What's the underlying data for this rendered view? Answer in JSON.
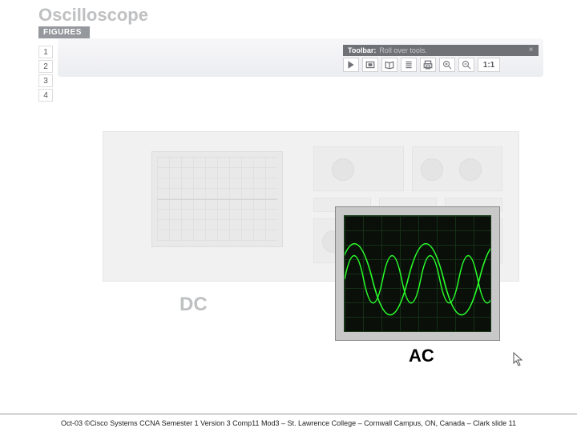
{
  "title": "Oscilloscope",
  "figures_tab": "FIGURES",
  "page_buttons": [
    "1",
    "2",
    "3",
    "4"
  ],
  "toolbar": {
    "label": "Toolbar:",
    "hint": "Roll over tools.",
    "ratio": "1:1"
  },
  "labels": {
    "dc": "DC",
    "ac": "AC"
  },
  "footer": "Oct-03 ©Cisco Systems CCNA Semester 1 Version 3 Comp11 Mod3 – St. Lawrence College – Cornwall Campus, ON, Canada – Clark slide 11"
}
